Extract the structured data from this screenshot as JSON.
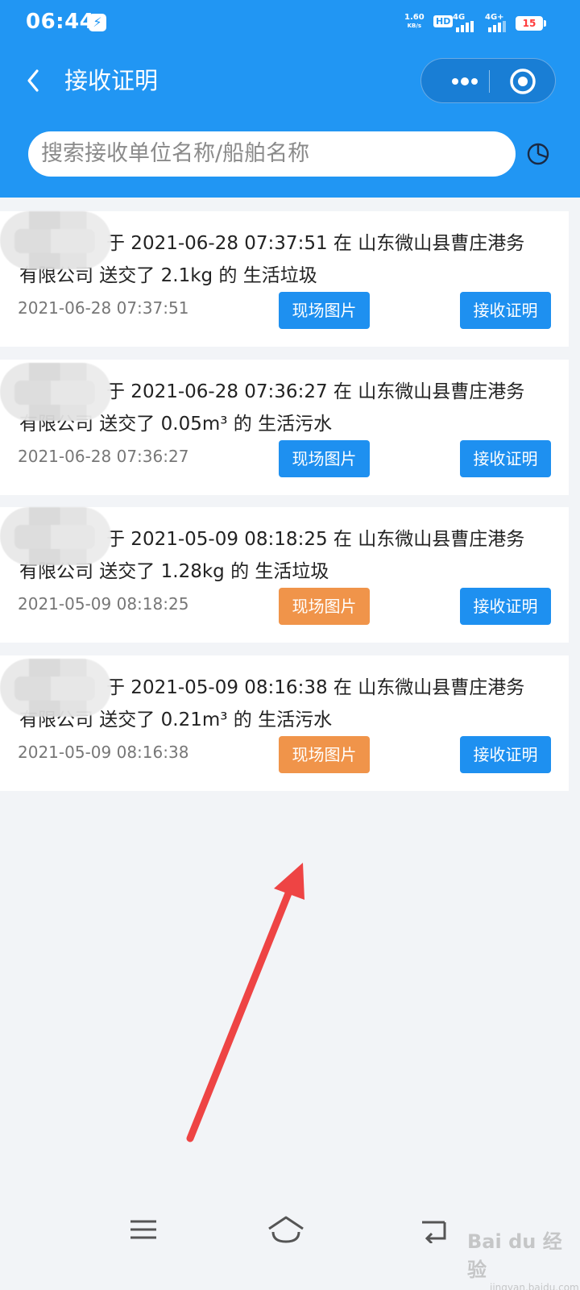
{
  "status_bar": {
    "time": "06:44",
    "net_speed": "1.60",
    "net_unit": "KB/s",
    "hd_label": "HD",
    "signal1": "4G",
    "signal2": "4G+",
    "battery": "15"
  },
  "header": {
    "title": "接收证明",
    "search_placeholder": "搜索接收单位名称/船舶名称"
  },
  "records": [
    {
      "line1": "于 2021-06-28 07:37:51 在 山东微山县曹庄港务",
      "line2": "有限公司 送交了 2.1kg 的 生活垃圾",
      "time": "2021-06-28 07:37:51",
      "photo_label": "现场图片",
      "photo_color": "#1e90f0",
      "cert_label": "接收证明"
    },
    {
      "line1": "于 2021-06-28 07:36:27 在 山东微山县曹庄港务",
      "line2": "有限公司 送交了 0.05m³ 的 生活污水",
      "time": "2021-06-28 07:36:27",
      "photo_label": "现场图片",
      "photo_color": "#1e90f0",
      "cert_label": "接收证明"
    },
    {
      "line1": "于 2021-05-09 08:18:25 在 山东微山县曹庄港务",
      "line2": "有限公司 送交了 1.28kg 的 生活垃圾",
      "time": "2021-05-09 08:18:25",
      "photo_label": "现场图片",
      "photo_color": "#f0944a",
      "cert_label": "接收证明"
    },
    {
      "line1": "于 2021-05-09 08:16:38 在 山东微山县曹庄港务",
      "line2": "有限公司 送交了 0.21m³ 的 生活污水",
      "time": "2021-05-09 08:16:38",
      "photo_label": "现场图片",
      "photo_color": "#f0944a",
      "cert_label": "接收证明"
    }
  ],
  "colors": {
    "primary": "#2196f3",
    "cert_button": "#1e90f0",
    "arrow": "#ee4444"
  },
  "icons": [
    "back-icon",
    "more-icon",
    "target-icon",
    "filter-icon",
    "menu-icon",
    "home-icon",
    "back-nav-icon"
  ],
  "watermark": {
    "main": "Bai du 经验",
    "sub": "jingyan.baidu.com"
  }
}
